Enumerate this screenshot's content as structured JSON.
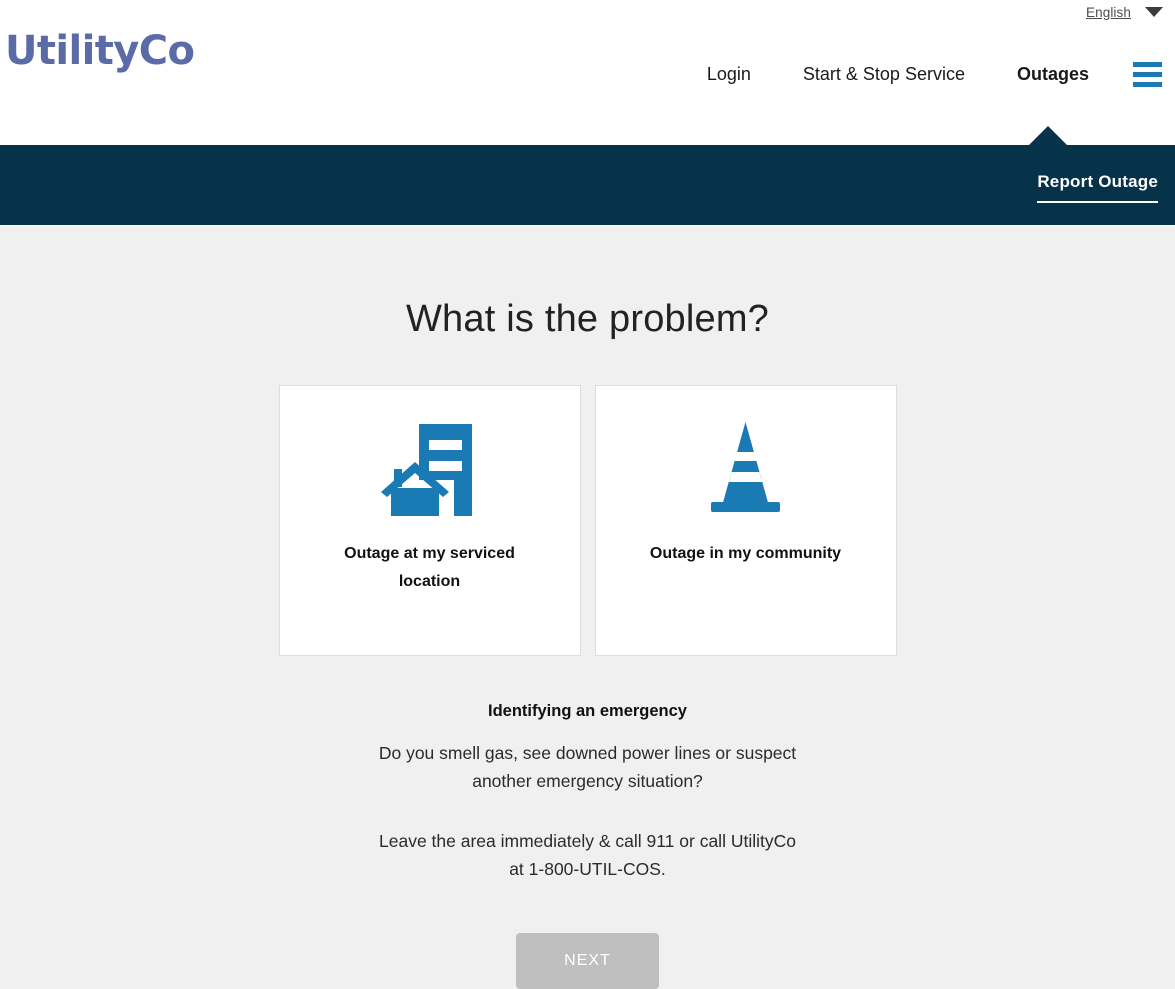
{
  "header": {
    "language": {
      "label": "English",
      "caret_icon": "chevron-down-icon"
    },
    "logo_text": "UtilityCo",
    "nav": [
      {
        "label": "Login",
        "active": false
      },
      {
        "label": "Start & Stop Service",
        "active": false
      },
      {
        "label": "Outages",
        "active": true
      }
    ],
    "menu_icon": "hamburger-menu-icon"
  },
  "subnav": {
    "link_label": "Report Outage"
  },
  "main": {
    "title": "What is the problem?",
    "cards": [
      {
        "label": "Outage at my serviced location",
        "icon": "building-and-house-icon"
      },
      {
        "label": "Outage in my community",
        "icon": "traffic-cone-icon"
      }
    ],
    "emergency": {
      "title": "Identifying an emergency",
      "paragraph_1": "Do you smell gas, see downed power lines or suspect another emergency situation?",
      "paragraph_2": "Leave the area immediately & call 911 or call UtilityCo at 1-800-UTIL-COS."
    },
    "next_button_label": "NEXT"
  },
  "colors": {
    "brand_logo": "#5b6ba8",
    "accent_blue": "#1a7ab3",
    "subnav_navy": "#06324a",
    "page_background": "#f0f0f0",
    "disabled_button": "#bfbfbf"
  }
}
